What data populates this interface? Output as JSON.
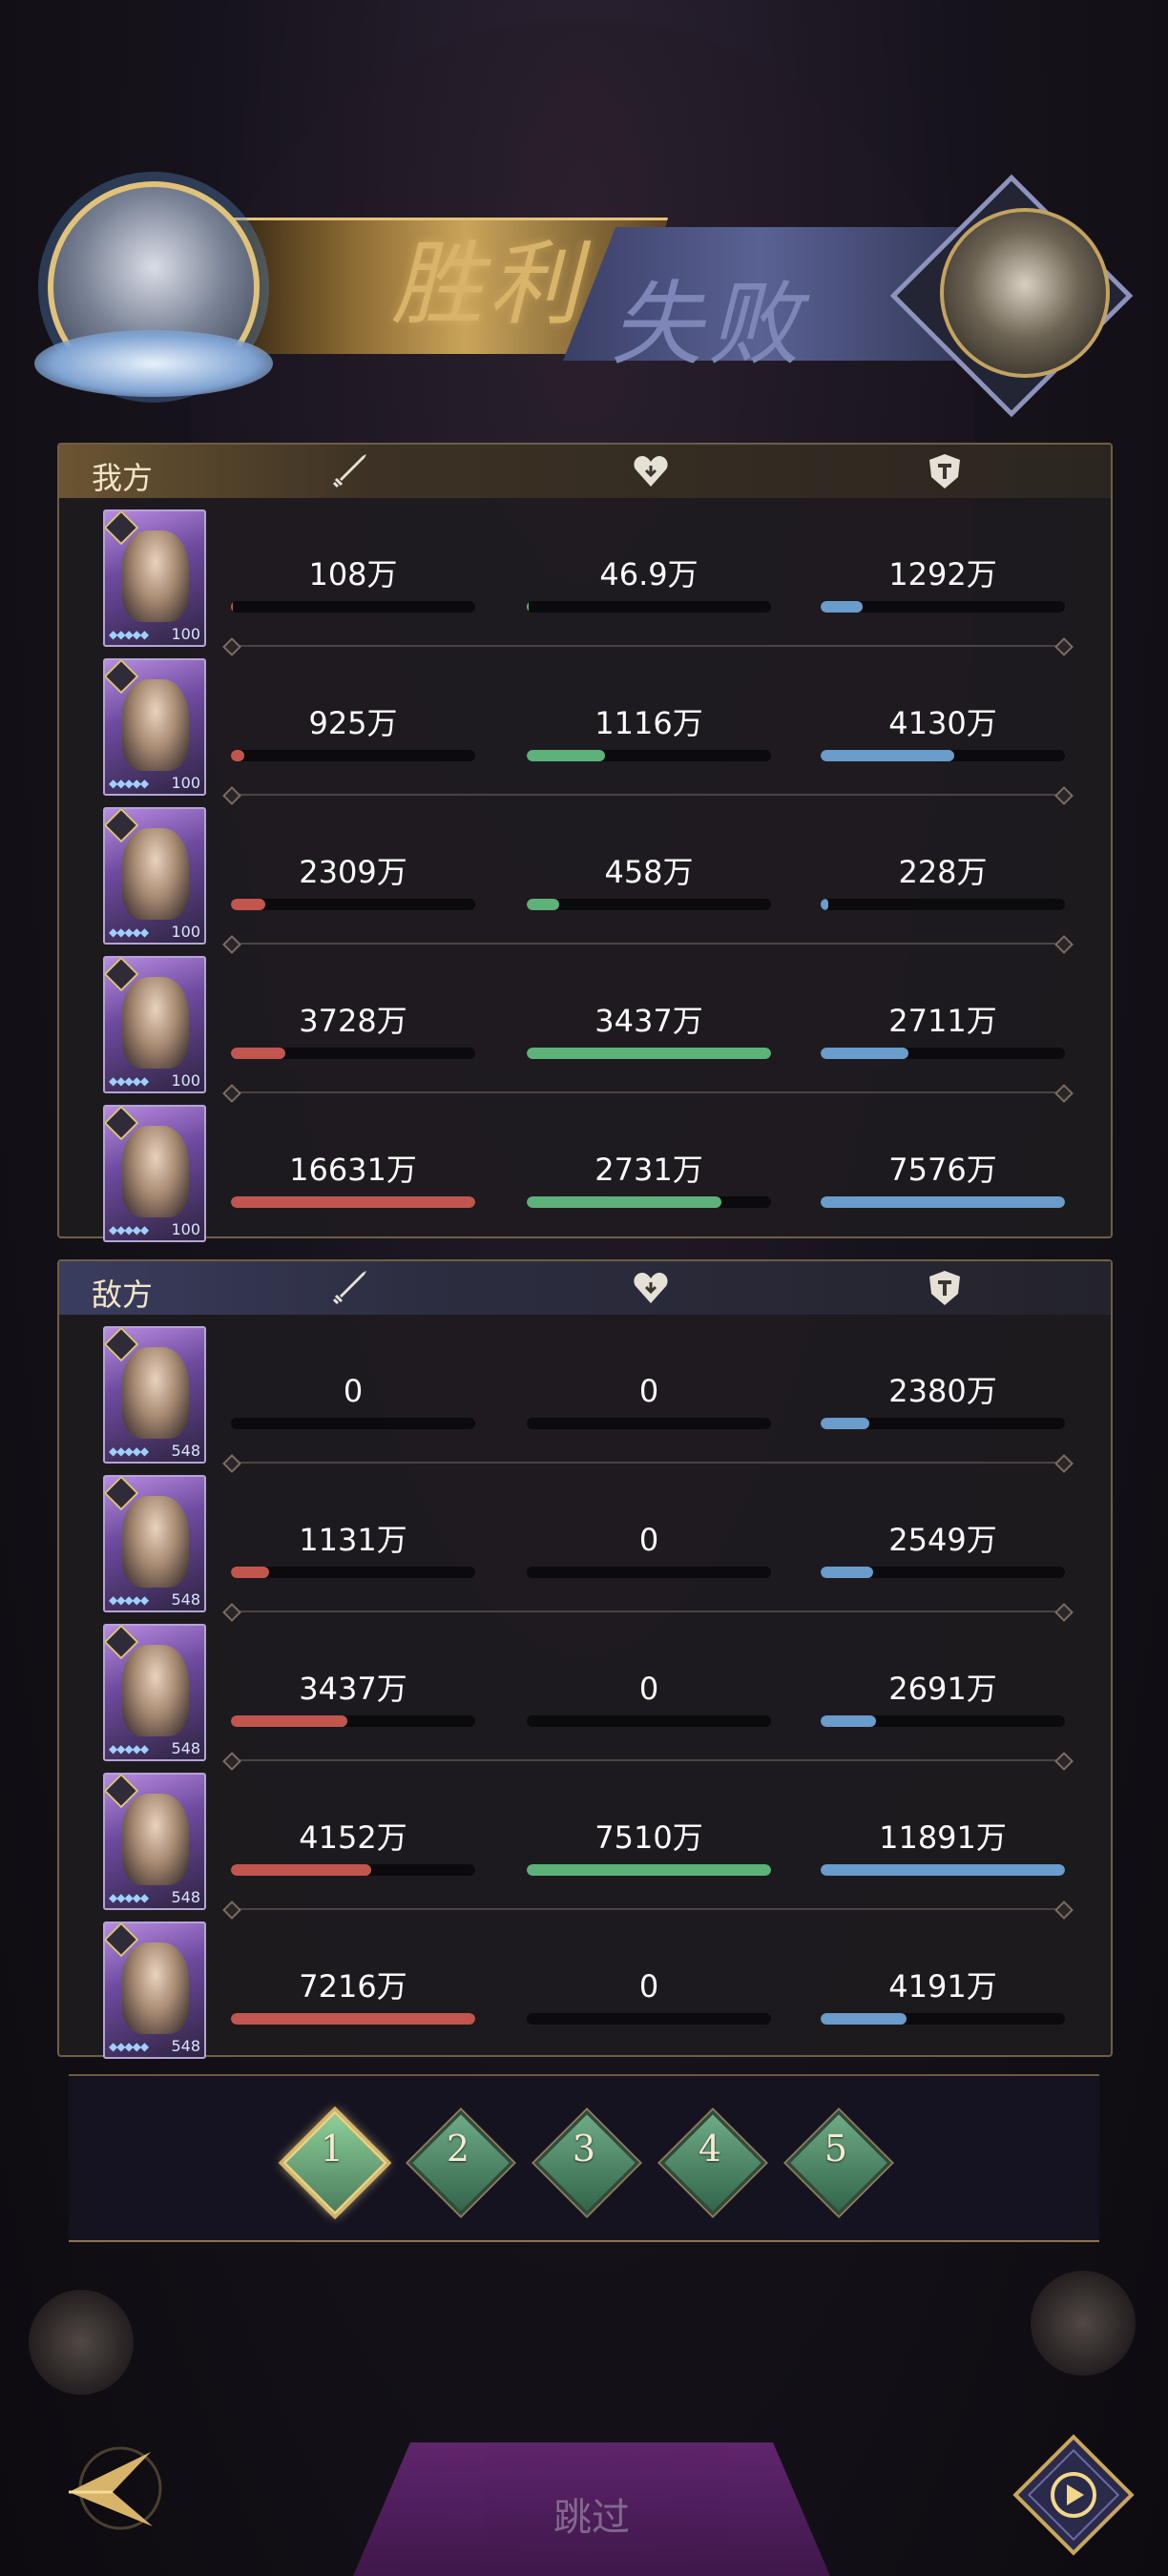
{
  "result": {
    "win_label": "胜利",
    "lose_label": "失败"
  },
  "ours": {
    "title": "我方",
    "rows": [
      {
        "level": "100",
        "atk": "108万",
        "heal": "46.9万",
        "def": "1292万",
        "atk_fill": 0.007,
        "heal_fill": 0.006,
        "def_fill": 0.17
      },
      {
        "level": "100",
        "atk": "925万",
        "heal": "1116万",
        "def": "4130万",
        "atk_fill": 0.056,
        "heal_fill": 0.32,
        "def_fill": 0.545
      },
      {
        "level": "100",
        "atk": "2309万",
        "heal": "458万",
        "def": "228万",
        "atk_fill": 0.139,
        "heal_fill": 0.133,
        "def_fill": 0.03
      },
      {
        "level": "100",
        "atk": "3728万",
        "heal": "3437万",
        "def": "2711万",
        "atk_fill": 0.224,
        "heal_fill": 1.0,
        "def_fill": 0.358
      },
      {
        "level": "100",
        "atk": "16631万",
        "heal": "2731万",
        "def": "7576万",
        "atk_fill": 1.0,
        "heal_fill": 0.795,
        "def_fill": 1.0
      }
    ]
  },
  "enemy": {
    "title": "敌方",
    "rows": [
      {
        "level": "548",
        "atk": "0",
        "heal": "0",
        "def": "2380万",
        "atk_fill": 0,
        "heal_fill": 0,
        "def_fill": 0.2
      },
      {
        "level": "548",
        "atk": "1131万",
        "heal": "0",
        "def": "2549万",
        "atk_fill": 0.157,
        "heal_fill": 0,
        "def_fill": 0.214
      },
      {
        "level": "548",
        "atk": "3437万",
        "heal": "0",
        "def": "2691万",
        "atk_fill": 0.476,
        "heal_fill": 0,
        "def_fill": 0.226
      },
      {
        "level": "548",
        "atk": "4152万",
        "heal": "7510万",
        "def": "11891万",
        "atk_fill": 0.575,
        "heal_fill": 1.0,
        "def_fill": 1.0
      },
      {
        "level": "548",
        "atk": "7216万",
        "heal": "0",
        "def": "4191万",
        "atk_fill": 1.0,
        "heal_fill": 0,
        "def_fill": 0.352
      }
    ]
  },
  "tabs": [
    "1",
    "2",
    "3",
    "4",
    "5"
  ],
  "active_tab": 0,
  "skip_label": "跳过",
  "icons": {
    "attack": "sword-icon",
    "heal": "heart-icon",
    "defense": "shield-icon",
    "back": "back-arrow-icon",
    "replay": "replay-icon"
  },
  "colors": {
    "attack": "#c2564f",
    "heal": "#5db27a",
    "defense": "#6a9ccc",
    "accent_gold": "#d8b46a"
  }
}
